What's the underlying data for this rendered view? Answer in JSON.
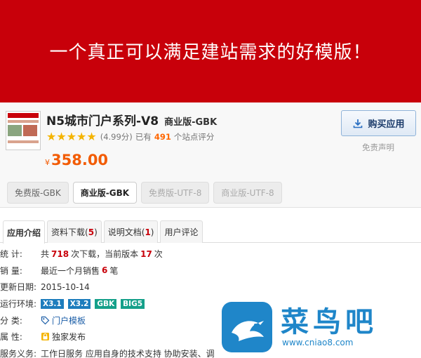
{
  "banner": {
    "text": "一个真正可以满足建站需求的好模版！"
  },
  "product": {
    "name": "N5城市门户系列-V8",
    "edition": "商业版-GBK",
    "rating": {
      "stars": 5,
      "score": "(4.99分)",
      "prefix": "已有",
      "count": "491",
      "suffix": "个站点评分"
    },
    "price": {
      "currency": "¥",
      "amount": "358.00"
    },
    "buy_label": "购买应用",
    "disclaimer": "免责声明",
    "editions": [
      {
        "label": "免费版-GBK",
        "state": "normal"
      },
      {
        "label": "商业版-GBK",
        "state": "active"
      },
      {
        "label": "免费版-UTF-8",
        "state": "disabled"
      },
      {
        "label": "商业版-UTF-8",
        "state": "disabled"
      }
    ]
  },
  "tabs": [
    {
      "label": "应用介绍",
      "count": ""
    },
    {
      "label": "资料下载(",
      "count": "5",
      "close": ")"
    },
    {
      "label": "说明文档(",
      "count": "1",
      "close": ")"
    },
    {
      "label": "用户评论",
      "count": ""
    }
  ],
  "info": {
    "stats": {
      "label": "统 计:",
      "t1": "共",
      "downloads": "718",
      "t2": "次下载，当前版本",
      "version_downloads": "17",
      "t3": "次"
    },
    "sales": {
      "label": "销 量:",
      "t1": "最近一个月销售",
      "count": "6",
      "t2": "笔"
    },
    "updated": {
      "label": "更新日期:",
      "value": "2015-10-14"
    },
    "env": {
      "label": "运行环境:",
      "badges": [
        "X3.1",
        "X3.2",
        "GBK",
        "BIG5"
      ]
    },
    "category": {
      "label": "分 类:",
      "value": "门户模板"
    },
    "attribute": {
      "label": "属 性:",
      "value": "独家发布"
    },
    "service": {
      "label": "服务义务:",
      "value": "工作日服务  应用自身的技术支持  协助安装、调"
    }
  },
  "logo": {
    "name": "菜鸟吧",
    "url": "www.cniao8.com"
  },
  "colors": {
    "brand_red": "#c8000a",
    "price_orange": "#f25c05",
    "star_yellow": "#f4b400",
    "logo_blue": "#1f86c9"
  }
}
